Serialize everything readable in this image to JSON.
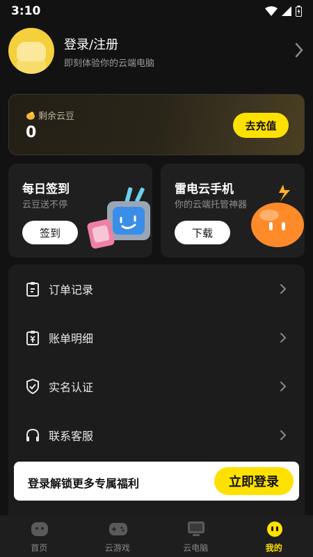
{
  "status_bar": {
    "time": "3:10"
  },
  "profile": {
    "title": "登录/注册",
    "subtitle": "即刻体验你的云端电脑"
  },
  "balance": {
    "label": "剩余云豆",
    "value": "0",
    "button": "去充值"
  },
  "promos": [
    {
      "title": "每日签到",
      "subtitle": "云豆送不停",
      "button": "签到"
    },
    {
      "title": "雷电云手机",
      "subtitle": "你的云端托管神器",
      "button": "下载"
    }
  ],
  "menu": [
    {
      "label": "订单记录",
      "icon": "clipboard-icon"
    },
    {
      "label": "账单明细",
      "icon": "bill-icon"
    },
    {
      "label": "实名认证",
      "icon": "shield-check-icon"
    },
    {
      "label": "联系客服",
      "icon": "headset-icon"
    }
  ],
  "login_banner": {
    "text": "登录解锁更多专属福利",
    "button": "立即登录"
  },
  "tabs": [
    {
      "label": "首页",
      "icon": "home-icon"
    },
    {
      "label": "云游戏",
      "icon": "gamepad-icon"
    },
    {
      "label": "云电脑",
      "icon": "monitor-icon"
    },
    {
      "label": "我的",
      "icon": "mascot-icon",
      "active": true
    }
  ],
  "colors": {
    "accent": "#ffe100",
    "background": "#121212",
    "card": "#1f1f1f"
  }
}
